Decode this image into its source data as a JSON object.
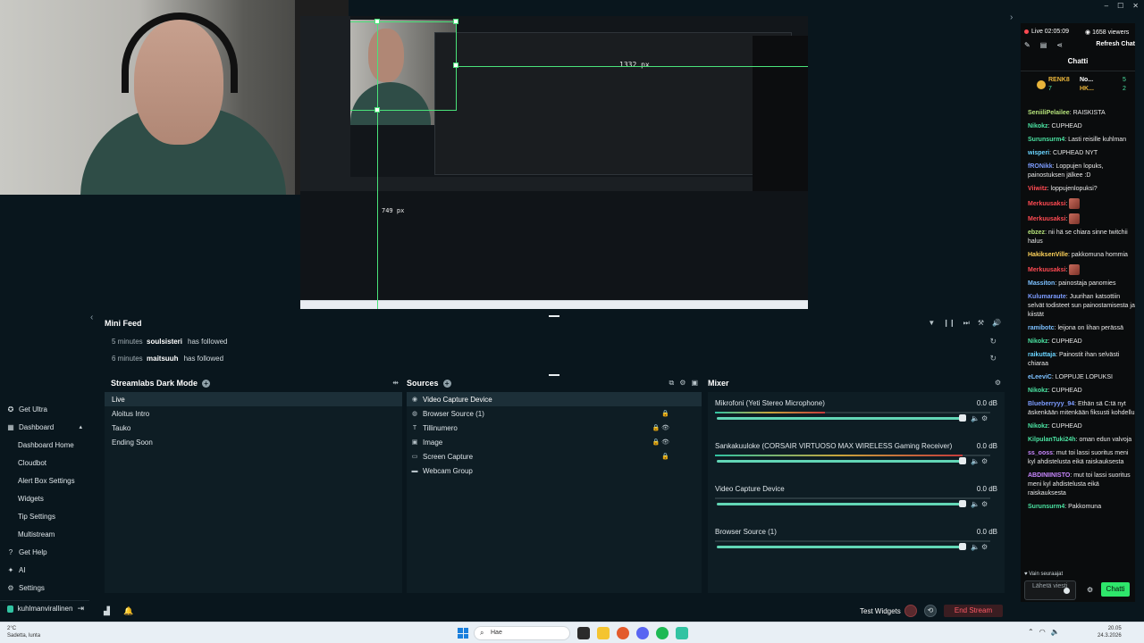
{
  "window_controls": {
    "minimize": "–",
    "maximize": "☐",
    "close": "✕"
  },
  "preview": {
    "nested_width_readout": "1332 px",
    "nested_height_readout": "749 px"
  },
  "nav": {
    "items": [
      {
        "label": "Get Ultra",
        "icon": "ultra-icon",
        "glyph": "✪"
      },
      {
        "label": "Dashboard",
        "icon": "dashboard-icon",
        "glyph": "▦",
        "caret": "▴"
      },
      {
        "label": "Dashboard Home",
        "sub": true
      },
      {
        "label": "Cloudbot",
        "sub": true
      },
      {
        "label": "Alert Box Settings",
        "sub": true
      },
      {
        "label": "Widgets",
        "sub": true
      },
      {
        "label": "Tip Settings",
        "sub": true
      },
      {
        "label": "Multistream",
        "sub": true
      },
      {
        "label": "Get Help",
        "icon": "help-icon",
        "glyph": "?"
      },
      {
        "label": "AI",
        "icon": "ai-icon",
        "glyph": "✦"
      },
      {
        "label": "Settings",
        "icon": "gear-icon",
        "glyph": "⚙"
      }
    ],
    "user": "kuhlmanvirallinen",
    "logout_glyph": "⇥"
  },
  "minifeed": {
    "title": "Mini Feed",
    "rows": [
      {
        "time": "5 minutes",
        "user": "soulsisteri",
        "action": "has followed"
      },
      {
        "time": "6 minutes",
        "user": "maitsuuh",
        "action": "has followed"
      }
    ],
    "tools": [
      "▼",
      "❙❙",
      "⏭",
      "⚒",
      "🔊"
    ],
    "replay_glyph": "↻"
  },
  "scenes": {
    "title": "Streamlabs Dark Mode",
    "items": [
      "Live",
      "Aloitus Intro",
      "Tauko",
      "Ending Soon"
    ],
    "selected": 0,
    "tool": "⇹"
  },
  "sources": {
    "title": "Sources",
    "items": [
      {
        "label": "Video Capture Device",
        "glyph": "◉",
        "icon": "camera-icon",
        "tools": ""
      },
      {
        "label": "Browser Source (1)",
        "glyph": "◍",
        "icon": "globe-icon",
        "tools": "🔒"
      },
      {
        "label": "Tillinumero",
        "glyph": "T",
        "icon": "text-icon",
        "tools": "🔒 👁"
      },
      {
        "label": "Image",
        "glyph": "▣",
        "icon": "image-icon",
        "tools": "🔒 👁"
      },
      {
        "label": "Screen Capture",
        "glyph": "▭",
        "icon": "monitor-icon",
        "tools": "🔒"
      },
      {
        "label": "Webcam Group",
        "glyph": "▬",
        "icon": "folder-icon",
        "tools": ""
      }
    ],
    "selected": 0,
    "tools": [
      "⧉",
      "⚙",
      "▣"
    ]
  },
  "mixer": {
    "title": "Mixer",
    "tool": "⚙",
    "items": [
      {
        "name": "Mikrofoni (Yeti Stereo Microphone)",
        "db": "0.0 dB",
        "level": 0.4
      },
      {
        "name": "Sankakuuloke (CORSAIR VIRTUOSO MAX WIRELESS Gaming Receiver)",
        "db": "0.0 dB",
        "level": 0.9
      },
      {
        "name": "Video Capture Device",
        "db": "0.0 dB",
        "level": 0
      },
      {
        "name": "Browser Source (1)",
        "db": "0.0 dB",
        "level": 0
      }
    ]
  },
  "footer": {
    "test_widgets": "Test Widgets",
    "end_stream": "End Stream",
    "replay_glyph": "⟲"
  },
  "chat": {
    "live": "Live 02:05:09",
    "viewers": "1658 viewers",
    "refresh": "Refresh Chat",
    "title": "Chatti",
    "hype_top": "RENK8",
    "hype_a": "No...",
    "hype_b": "HK...",
    "hype_count1": "7",
    "hype_count2": "5",
    "hype_count3": "2",
    "messages": [
      {
        "user": "SeniiliPelailee",
        "color": "#b5e27a",
        "text": "RAISKISTA"
      },
      {
        "user": "Nikokz",
        "color": "#4be3a2",
        "text": "CUPHEAD"
      },
      {
        "user": "Surunsurm4",
        "color": "#4be3a2",
        "text": "Lasti reisille kuhlman"
      },
      {
        "user": "wisperi",
        "color": "#6ad4ff",
        "text": "CUPHEAD NYT"
      },
      {
        "user": "fRONikk",
        "color": "#7c9cff",
        "text": "Loppujen lopuks, painostuksen jälkee :D"
      },
      {
        "user": "Viiwitz",
        "color": "#ff4a52",
        "text": "loppujenlopuksi?"
      },
      {
        "user": "Merkuusaksi",
        "color": "#ff4a52",
        "text": "",
        "emote": true
      },
      {
        "user": "Merkuusaksi",
        "color": "#ff4a52",
        "text": "",
        "emote": true
      },
      {
        "user": "ebzez",
        "color": "#b5e27a",
        "text": "nii hä se chiara sinne twitchii halus"
      },
      {
        "user": "HakiksenVille",
        "color": "#ffd35a",
        "text": "pakkomuna hommia"
      },
      {
        "user": "Merkuusaksi",
        "color": "#ff4a52",
        "text": "",
        "emote": true
      },
      {
        "user": "Massiton",
        "color": "#7cc0ff",
        "text": "painostaja panomies"
      },
      {
        "user": "Kulumaraute",
        "color": "#7c9cff",
        "text": "Juurihan katsottiin selvät todisteet sun painostamisesta ja kiistät"
      },
      {
        "user": "ramibotc",
        "color": "#7cc0ff",
        "text": "leijona on lihan perässä"
      },
      {
        "user": "Nikokz",
        "color": "#4be3a2",
        "text": "CUPHEAD"
      },
      {
        "user": "raikuttaja",
        "color": "#6ad4ff",
        "text": "Painostit ihan selvästi chiaraa"
      },
      {
        "user": "eLeeviC",
        "color": "#7cc0ff",
        "text": "LOPPUJE LOPUKSI"
      },
      {
        "user": "Nikokz",
        "color": "#4be3a2",
        "text": "CUPHEAD"
      },
      {
        "user": "Blueberryyy_94",
        "color": "#7c9cff",
        "text": "Ethän sä C:tä nyt äskenkään mitenkään fiksusti kohdellu"
      },
      {
        "user": "Nikokz",
        "color": "#4be3a2",
        "text": "CUPHEAD"
      },
      {
        "user": "KilpulanTuki24h",
        "color": "#4be3a2",
        "text": "oman edun valvoja"
      },
      {
        "user": "ss_ooss",
        "color": "#c987ff",
        "text": "mut toi lassi suoritus meni kyl ahdistelusta eikä raiskauksesta"
      },
      {
        "user": "ABDINIINISTO",
        "color": "#c987ff",
        "text": "mut toi lassi suoritus meni kyl ahdistelusta eikä raiskauksesta"
      },
      {
        "user": "Surunsurm4",
        "color": "#4be3a2",
        "text": "Pakkomuna"
      }
    ],
    "follow_only": "♥ Vain seuraajat",
    "send_placeholder": "Lähetä viesti",
    "send_button": "Chatti"
  },
  "taskbar": {
    "temp": "2°C",
    "weather": "Sadetta, lunta",
    "search": "Hae",
    "time": "20.05",
    "date": "24.3.2026"
  },
  "colors": {
    "accent": "#31c3a2",
    "end_stream": "#ff5a66",
    "chat_button": "#2ee66b"
  }
}
